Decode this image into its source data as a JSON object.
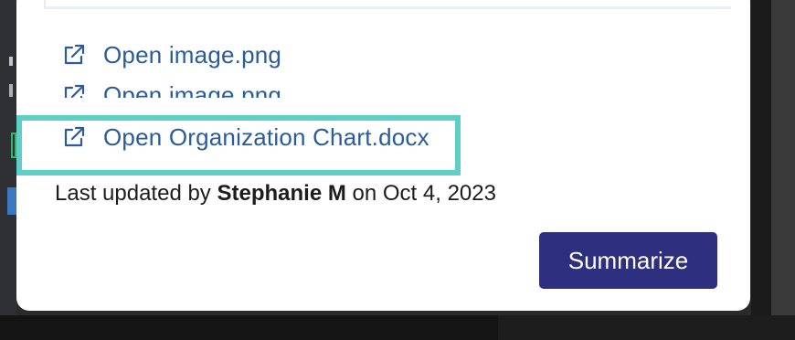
{
  "attachments": [
    {
      "label": "Open image.png",
      "icon": "external-link-icon"
    },
    {
      "label": "Open image.png",
      "icon": "external-link-icon"
    },
    {
      "label": "Open Organization Chart.docx",
      "icon": "external-link-icon"
    }
  ],
  "updated": {
    "prefix": "Last updated by",
    "user": "Stephanie M",
    "middle": "on",
    "date": "Oct 4, 2023"
  },
  "actions": {
    "summarize_label": "Summarize"
  },
  "colors": {
    "link": "#2a5b9b",
    "highlight": "#5ecfc7",
    "button": "#2f2f7f"
  }
}
